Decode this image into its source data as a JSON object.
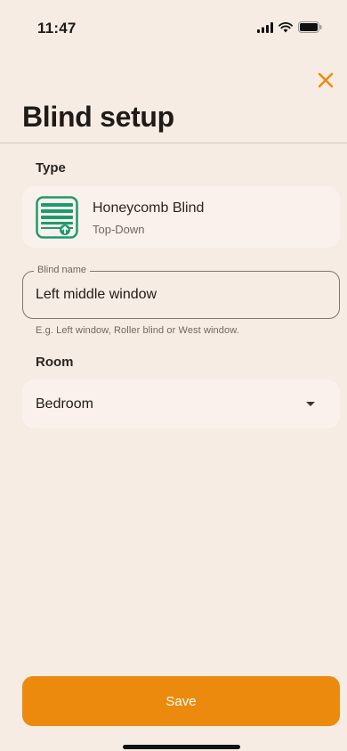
{
  "status_bar": {
    "time": "11:47",
    "icons": [
      "signal-icon",
      "wifi-icon",
      "battery-icon"
    ]
  },
  "header": {
    "close_icon": "close-icon",
    "title": "Blind setup"
  },
  "type_section": {
    "label": "Type",
    "card": {
      "icon": "honeycomb-blind-icon",
      "name": "Honeycomb Blind",
      "subtitle": "Top-Down"
    }
  },
  "name_field": {
    "label": "Blind name",
    "value": "Left middle window",
    "helper": "E.g. Left window, Roller blind or West window."
  },
  "room_section": {
    "label": "Room",
    "selected": "Bedroom",
    "arrow_icon": "dropdown-arrow-icon"
  },
  "footer": {
    "save_label": "Save"
  },
  "colors": {
    "background": "#f7ece3",
    "accent": "#eb8a0c",
    "card": "#fbf1ec",
    "icon_green": "#1e9a6f"
  }
}
